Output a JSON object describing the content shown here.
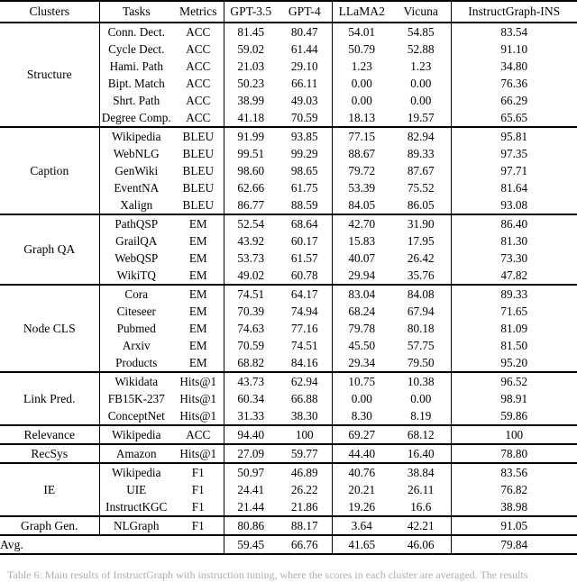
{
  "table": {
    "headers": [
      "Clusters",
      "Tasks",
      "Metrics",
      "GPT-3.5",
      "GPT-4",
      "LLaMA2",
      "Vicuna",
      "InstructGraph-INS"
    ],
    "groups": [
      {
        "cluster": "Structure",
        "rows": [
          {
            "task": "Conn. Dect.",
            "metric": "ACC",
            "gpt35": "81.45",
            "gpt4": "80.47",
            "llama2": "54.01",
            "vicuna": "54.85",
            "ins": "83.54",
            "bold": [
              "ins"
            ]
          },
          {
            "task": "Cycle Dect.",
            "metric": "ACC",
            "gpt35": "59.02",
            "gpt4": "61.44",
            "llama2": "50.79",
            "vicuna": "52.88",
            "ins": "91.10",
            "bold": [
              "ins"
            ]
          },
          {
            "task": "Hami. Path",
            "metric": "ACC",
            "gpt35": "21.03",
            "gpt4": "29.10",
            "llama2": "1.23",
            "vicuna": "1.23",
            "ins": "34.80",
            "bold": [
              "ins"
            ]
          },
          {
            "task": "Bipt. Match",
            "metric": "ACC",
            "gpt35": "50.23",
            "gpt4": "66.11",
            "llama2": "0.00",
            "vicuna": "0.00",
            "ins": "76.36",
            "bold": [
              "ins"
            ]
          },
          {
            "task": "Shrt. Path",
            "metric": "ACC",
            "gpt35": "38.99",
            "gpt4": "49.03",
            "llama2": "0.00",
            "vicuna": "0.00",
            "ins": "66.29",
            "bold": [
              "ins"
            ]
          },
          {
            "task": "Degree Comp.",
            "metric": "ACC",
            "gpt35": "41.18",
            "gpt4": "70.59",
            "llama2": "18.13",
            "vicuna": "19.57",
            "ins": "65.65",
            "bold": [
              "gpt4"
            ]
          }
        ]
      },
      {
        "cluster": "Caption",
        "rows": [
          {
            "task": "Wikipedia",
            "metric": "BLEU",
            "gpt35": "91.99",
            "gpt4": "93.85",
            "llama2": "77.15",
            "vicuna": "82.94",
            "ins": "95.81",
            "bold": [
              "ins"
            ]
          },
          {
            "task": "WebNLG",
            "metric": "BLEU",
            "gpt35": "99.51",
            "gpt4": "99.29",
            "llama2": "88.67",
            "vicuna": "89.33",
            "ins": "97.35",
            "bold": [
              "gpt35"
            ]
          },
          {
            "task": "GenWiki",
            "metric": "BLEU",
            "gpt35": "98.60",
            "gpt4": "98.65",
            "llama2": "79.72",
            "vicuna": "87.67",
            "ins": "97.71",
            "bold": [
              "gpt4"
            ]
          },
          {
            "task": "EventNA",
            "metric": "BLEU",
            "gpt35": "62.66",
            "gpt4": "61.75",
            "llama2": "53.39",
            "vicuna": "75.52",
            "ins": "81.64",
            "bold": [
              "ins"
            ]
          },
          {
            "task": "Xalign",
            "metric": "BLEU",
            "gpt35": "86.77",
            "gpt4": "88.59",
            "llama2": "84.05",
            "vicuna": "86.05",
            "ins": "93.08",
            "bold": [
              "ins"
            ]
          }
        ]
      },
      {
        "cluster": "Graph QA",
        "rows": [
          {
            "task": "PathQSP",
            "metric": "EM",
            "gpt35": "52.54",
            "gpt4": "68.64",
            "llama2": "42.70",
            "vicuna": "31.90",
            "ins": "86.40",
            "bold": [
              "ins"
            ]
          },
          {
            "task": "GrailQA",
            "metric": "EM",
            "gpt35": "43.92",
            "gpt4": "60.17",
            "llama2": "15.83",
            "vicuna": "17.95",
            "ins": "81.30",
            "bold": [
              "ins"
            ]
          },
          {
            "task": "WebQSP",
            "metric": "EM",
            "gpt35": "53.73",
            "gpt4": "61.57",
            "llama2": "40.07",
            "vicuna": "26.42",
            "ins": "73.30",
            "bold": [
              "ins"
            ]
          },
          {
            "task": "WikiTQ",
            "metric": "EM",
            "gpt35": "49.02",
            "gpt4": "60.78",
            "llama2": "29.94",
            "vicuna": "35.76",
            "ins": "47.82",
            "bold": [
              "gpt4"
            ]
          }
        ]
      },
      {
        "cluster": "Node CLS",
        "rows": [
          {
            "task": "Cora",
            "metric": "EM",
            "gpt35": "74.51",
            "gpt4": "64.17",
            "llama2": "83.04",
            "vicuna": "84.08",
            "ins": "89.33",
            "bold": [
              "ins"
            ]
          },
          {
            "task": "Citeseer",
            "metric": "EM",
            "gpt35": "70.39",
            "gpt4": "74.94",
            "llama2": "68.24",
            "vicuna": "67.94",
            "ins": "71.65",
            "bold": [
              "gpt4"
            ]
          },
          {
            "task": "Pubmed",
            "metric": "EM",
            "gpt35": "74.63",
            "gpt4": "77.16",
            "llama2": "79.78",
            "vicuna": "80.18",
            "ins": "81.09",
            "bold": [
              "ins"
            ]
          },
          {
            "task": "Arxiv",
            "metric": "EM",
            "gpt35": "70.59",
            "gpt4": "74.51",
            "llama2": "45.50",
            "vicuna": "57.75",
            "ins": "81.50",
            "bold": [
              "ins"
            ]
          },
          {
            "task": "Products",
            "metric": "EM",
            "gpt35": "68.82",
            "gpt4": "84.16",
            "llama2": "29.34",
            "vicuna": "79.50",
            "ins": "95.20",
            "bold": [
              "ins"
            ]
          }
        ]
      },
      {
        "cluster": "Link Pred.",
        "rows": [
          {
            "task": "Wikidata",
            "metric": "Hits@1",
            "gpt35": "43.73",
            "gpt4": "62.94",
            "llama2": "10.75",
            "vicuna": "10.38",
            "ins": "96.52",
            "bold": [
              "ins"
            ]
          },
          {
            "task": "FB15K-237",
            "metric": "Hits@1",
            "gpt35": "60.34",
            "gpt4": "66.88",
            "llama2": "0.00",
            "vicuna": "0.00",
            "ins": "98.91",
            "bold": [
              "ins"
            ]
          },
          {
            "task": "ConceptNet",
            "metric": "Hits@1",
            "gpt35": "31.33",
            "gpt4": "38.30",
            "llama2": "8.30",
            "vicuna": "8.19",
            "ins": "59.86",
            "bold": [
              "ins"
            ]
          }
        ]
      },
      {
        "cluster": "Relevance",
        "rows": [
          {
            "task": "Wikipedia",
            "metric": "ACC",
            "gpt35": "94.40",
            "gpt4": "100",
            "llama2": "69.27",
            "vicuna": "68.12",
            "ins": "100",
            "bold": [
              "gpt4",
              "ins"
            ]
          }
        ]
      },
      {
        "cluster": "RecSys",
        "rows": [
          {
            "task": "Amazon",
            "metric": "Hits@1",
            "gpt35": "27.09",
            "gpt4": "59.77",
            "llama2": "44.40",
            "vicuna": "16.40",
            "ins": "78.80",
            "bold": [
              "ins"
            ]
          }
        ]
      },
      {
        "cluster": "IE",
        "rows": [
          {
            "task": "Wikipedia",
            "metric": "F1",
            "gpt35": "50.97",
            "gpt4": "46.89",
            "llama2": "40.76",
            "vicuna": "38.84",
            "ins": "83.56",
            "bold": [
              "ins"
            ]
          },
          {
            "task": "UIE",
            "metric": "F1",
            "gpt35": "24.41",
            "gpt4": "26.22",
            "llama2": "20.21",
            "vicuna": "26.11",
            "ins": "76.82",
            "bold": [
              "ins"
            ]
          },
          {
            "task": "InstructKGC",
            "metric": "F1",
            "gpt35": "21.44",
            "gpt4": "21.86",
            "llama2": "19.26",
            "vicuna": "16.6",
            "ins": "38.98",
            "bold": [
              "ins"
            ]
          }
        ]
      },
      {
        "cluster": "Graph Gen.",
        "rows": [
          {
            "task": "NLGraph",
            "metric": "F1",
            "gpt35": "80.86",
            "gpt4": "88.17",
            "llama2": "3.64",
            "vicuna": "42.21",
            "ins": "91.05",
            "bold": [
              "ins"
            ]
          }
        ]
      }
    ],
    "average": {
      "label": "Avg.",
      "gpt35": "59.45",
      "gpt4": "66.76",
      "llama2": "41.65",
      "vicuna": "46.06",
      "ins": "79.84",
      "bold": [
        "ins"
      ]
    }
  },
  "caption": {
    "text": "Table 6: Main results of InstructGraph with instruction tuning, where the scores in each cluster are averaged. The results"
  }
}
